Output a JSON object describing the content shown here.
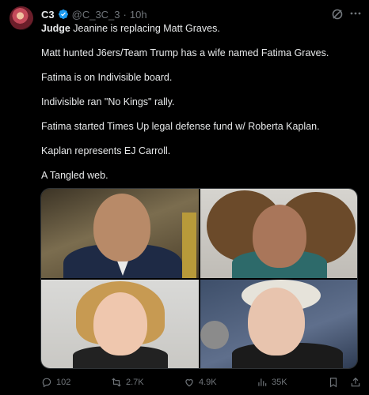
{
  "author": {
    "name": "C3",
    "handle": "@C_3C_3",
    "separator": "·",
    "time": "10h"
  },
  "tweet": {
    "lines": [
      {
        "bold": "Judge",
        "rest": " Jeanine is replacing Matt Graves."
      },
      {
        "text": "Matt hunted J6ers/Team Trump has a wife named Fatima Graves."
      },
      {
        "text": "Fatima is on Indivisible board."
      },
      {
        "text": "Indivisible ran \"No Kings\" rally."
      },
      {
        "text": "Fatima started Times Up legal defense fund w/ Roberta Kaplan."
      },
      {
        "text": "Kaplan represents EJ Carroll."
      },
      {
        "text": "A Tangled web."
      }
    ]
  },
  "actions": {
    "replies": "102",
    "reposts": "2.7K",
    "likes": "4.9K",
    "views": "35K"
  },
  "icons": [
    "verified-badge-icon",
    "grok-icon",
    "more-icon",
    "reply-icon",
    "repost-icon",
    "like-icon",
    "views-icon",
    "bookmark-icon",
    "share-icon"
  ],
  "colors": {
    "background": "#000000",
    "text": "#e7e9ea",
    "muted": "#71767b",
    "verified": "#1d9bf0"
  }
}
